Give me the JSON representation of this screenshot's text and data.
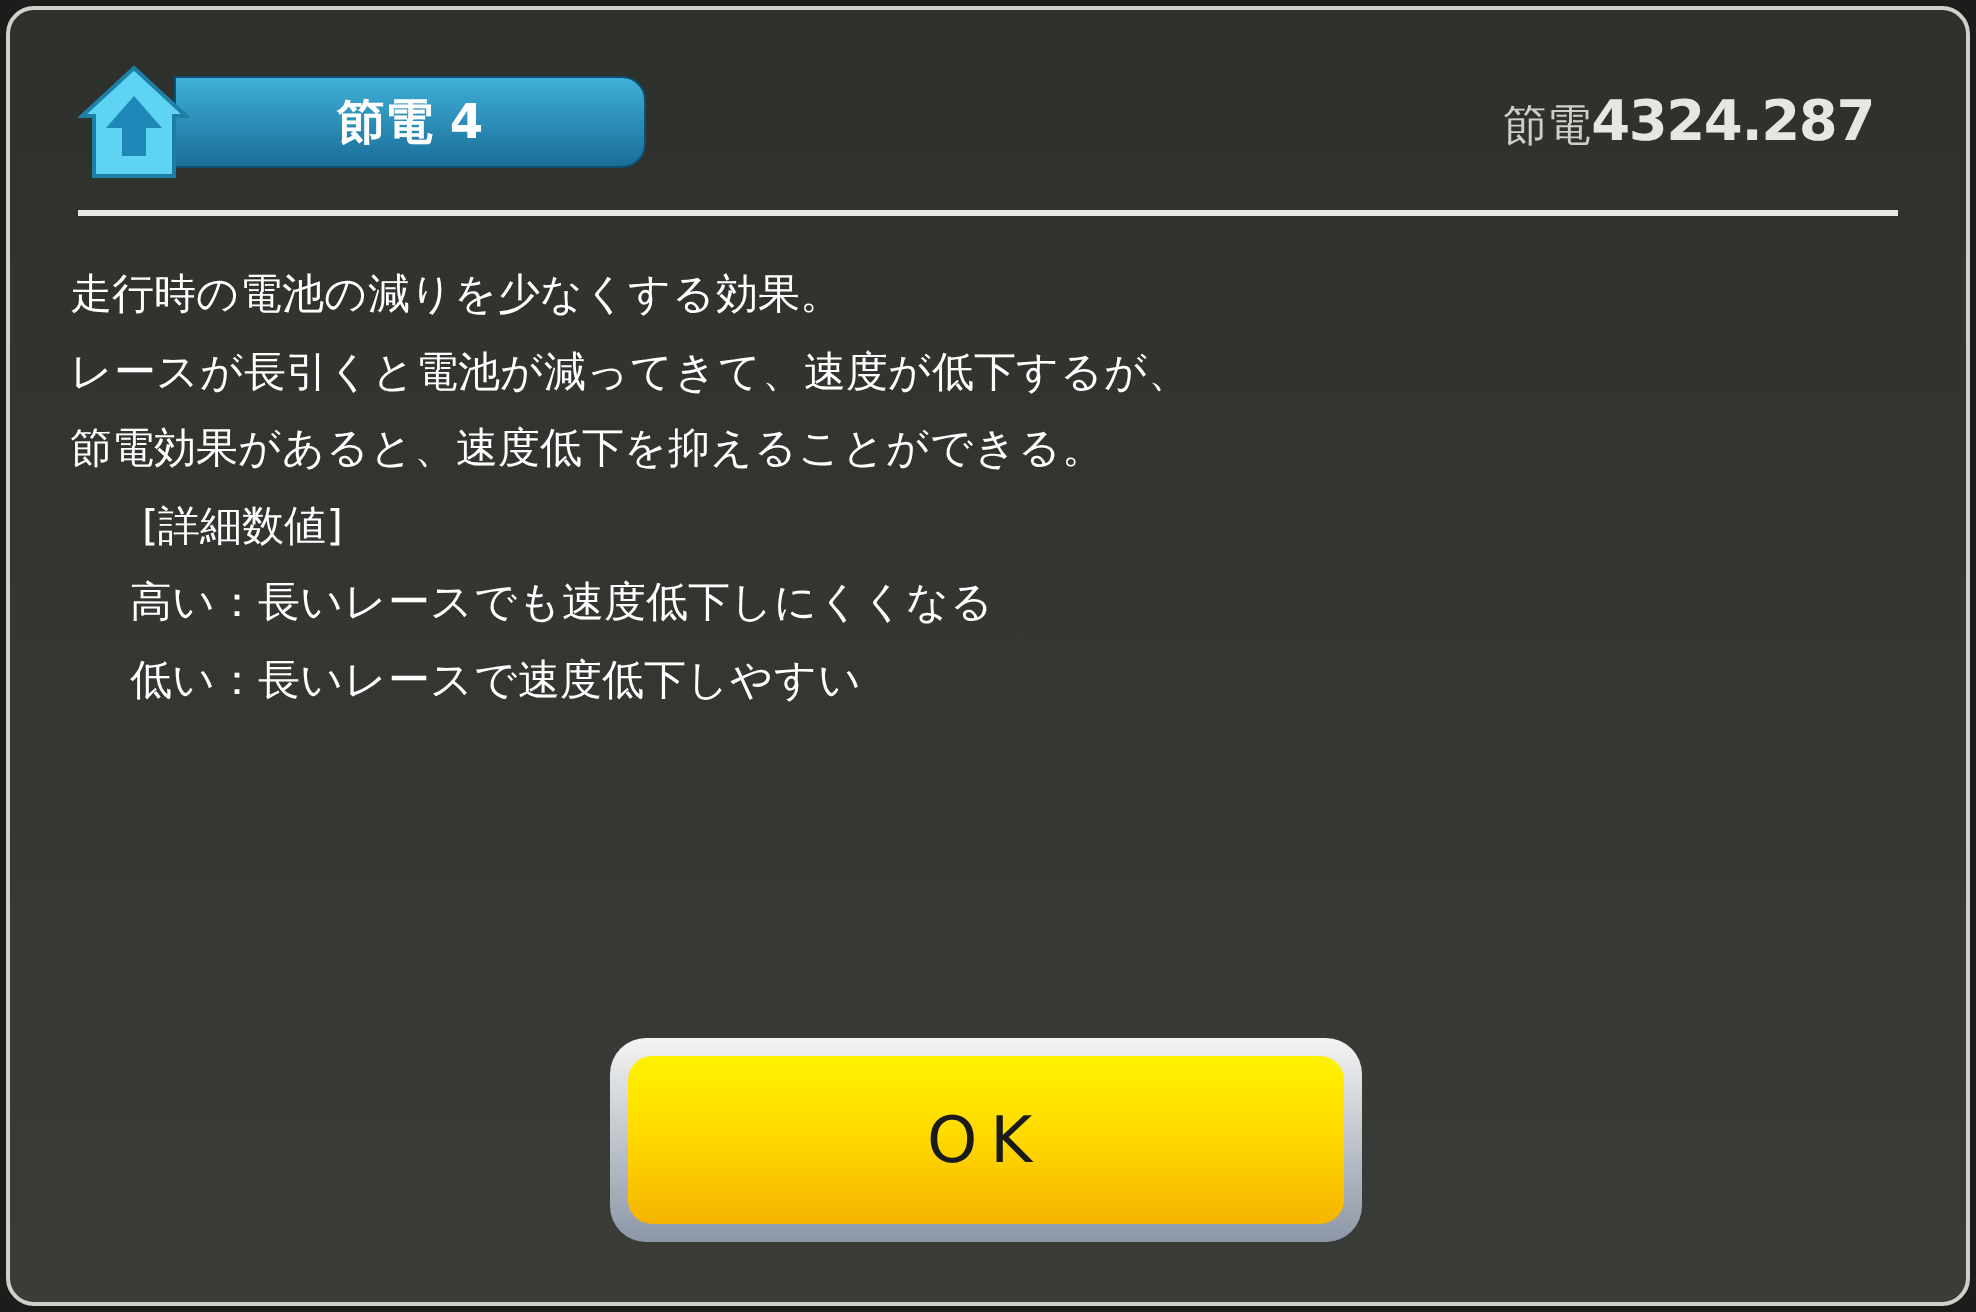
{
  "header": {
    "title": "節電 4",
    "stat_label": "節電",
    "stat_value": "4324.287"
  },
  "description": [
    "走行時の電池の減りを少なくする効果。",
    "レースが長引くと電池が減ってきて、速度が低下するが、",
    "節電効果があると、速度低下を抑えることができる。"
  ],
  "details": {
    "heading": "[詳細数値]",
    "items": [
      "高い：長いレースでも速度低下しにくくなる",
      "低い：長いレースで速度低下しやすい"
    ]
  },
  "button": "OK"
}
